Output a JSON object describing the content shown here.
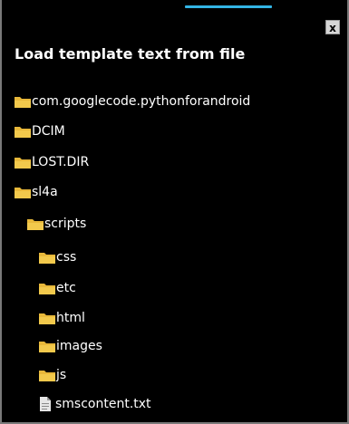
{
  "dialog": {
    "title": "Load template text from file",
    "close_label": "x"
  },
  "tree": {
    "items": [
      {
        "label": "com.googlecode.pythonforandroid",
        "type": "folder"
      },
      {
        "label": "DCIM",
        "type": "folder"
      },
      {
        "label": "LOST.DIR",
        "type": "folder"
      },
      {
        "label": "sl4a",
        "type": "folder"
      },
      {
        "label": "scripts",
        "type": "folder"
      },
      {
        "label": "css",
        "type": "folder"
      },
      {
        "label": "etc",
        "type": "folder"
      },
      {
        "label": "html",
        "type": "folder"
      },
      {
        "label": "images",
        "type": "folder"
      },
      {
        "label": "js",
        "type": "folder"
      },
      {
        "label": "smscontent.txt",
        "type": "file"
      }
    ]
  },
  "colors": {
    "background": "#000000",
    "text": "#ffffff",
    "folder": "#e8b83a",
    "accent": "#33b5e5"
  },
  "icons": {
    "folder": "folder-icon",
    "file": "file-icon",
    "close": "close-icon"
  }
}
